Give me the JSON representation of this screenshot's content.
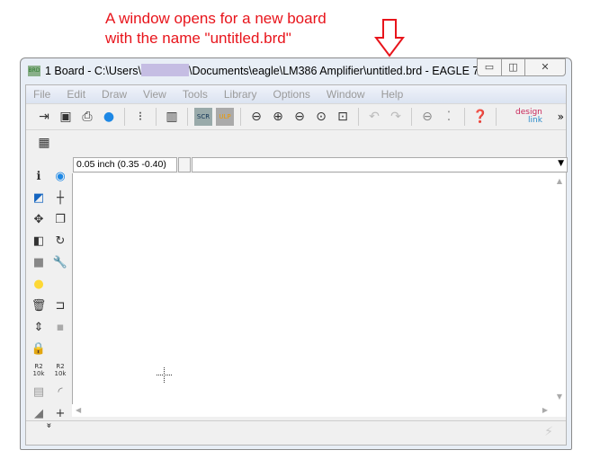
{
  "annotation": {
    "line1": "A window opens for a new board",
    "line2": "with the name \"untitled.brd\""
  },
  "window": {
    "icon_label": "BRD",
    "title_prefix": "1 Board - C:\\Users\\",
    "title_suffix": "\\Documents\\eagle\\LM386 Amplifier\\untitled.brd - EAGLE 7....",
    "minimize": "▭",
    "maximize": "◫",
    "close": "✕"
  },
  "menu": [
    "File",
    "Edit",
    "Draw",
    "View",
    "Tools",
    "Library",
    "Options",
    "Window",
    "Help"
  ],
  "toolbar": {
    "scr": "SCR",
    "ulp": "ULP",
    "design": "design",
    "link": "link",
    "more": "»"
  },
  "command": {
    "coord": "0.05 inch (0.35 -0.40)",
    "dropdown": "▼"
  },
  "sidebar": {
    "r2a": "R2",
    "val_a": "10k",
    "r2b": "R2",
    "val_b": "10k",
    "more": "»"
  },
  "colors": {
    "annotation": "#e8141b",
    "redaction": "#c5bde3"
  }
}
